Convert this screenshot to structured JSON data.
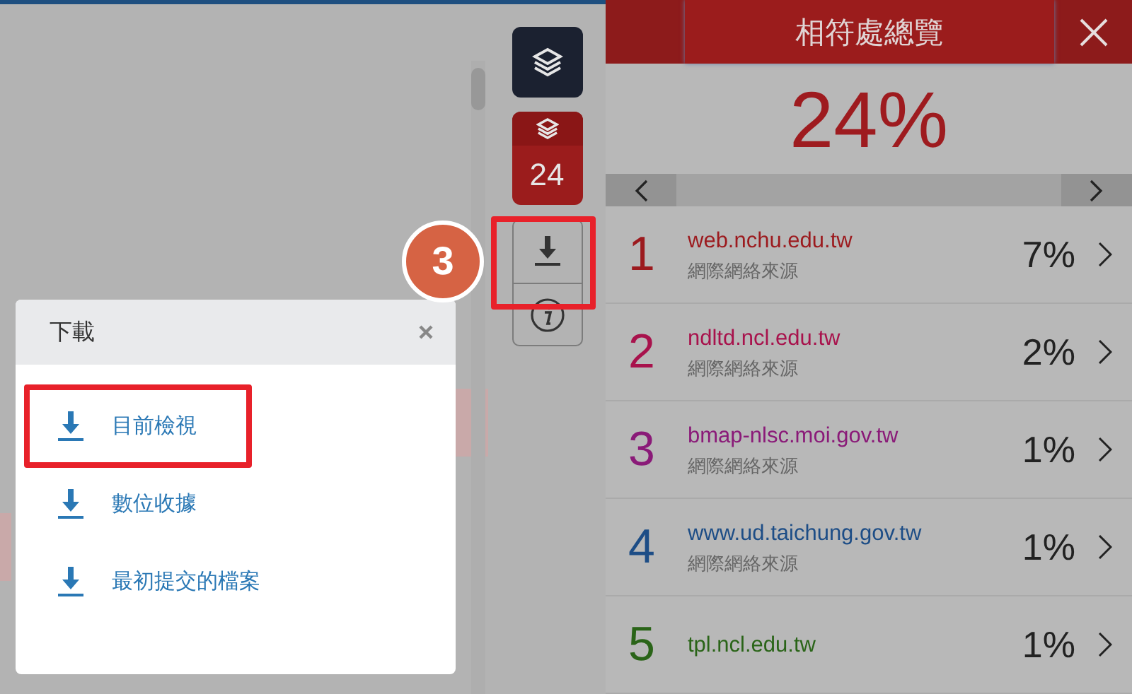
{
  "toolbar": {
    "match_count": "24",
    "download_marked": true
  },
  "panel": {
    "title": "相符處總覽",
    "percentage": "24%"
  },
  "sources": [
    {
      "rank": "1",
      "domain": "web.nchu.edu.tw",
      "type": "網際網絡來源",
      "percent": "7%",
      "color": "#9c1a1e"
    },
    {
      "rank": "2",
      "domain": "ndltd.ncl.edu.tw",
      "type": "網際網絡來源",
      "percent": "2%",
      "color": "#a8124c"
    },
    {
      "rank": "3",
      "domain": "bmap-nlsc.moi.gov.tw",
      "type": "網際網絡來源",
      "percent": "1%",
      "color": "#8a1a78"
    },
    {
      "rank": "4",
      "domain": "www.ud.taichung.gov.tw",
      "type": "網際網絡來源",
      "percent": "1%",
      "color": "#1d4d86"
    },
    {
      "rank": "5",
      "domain": "tpl.ncl.edu.tw",
      "percent": "1%",
      "color": "#2a6418"
    }
  ],
  "download_dialog": {
    "title": "下載",
    "options": [
      {
        "label": "目前檢視",
        "marked": true
      },
      {
        "label": "數位收據",
        "marked": false
      },
      {
        "label": "最初提交的檔案",
        "marked": false
      }
    ]
  },
  "step_badge": "3"
}
